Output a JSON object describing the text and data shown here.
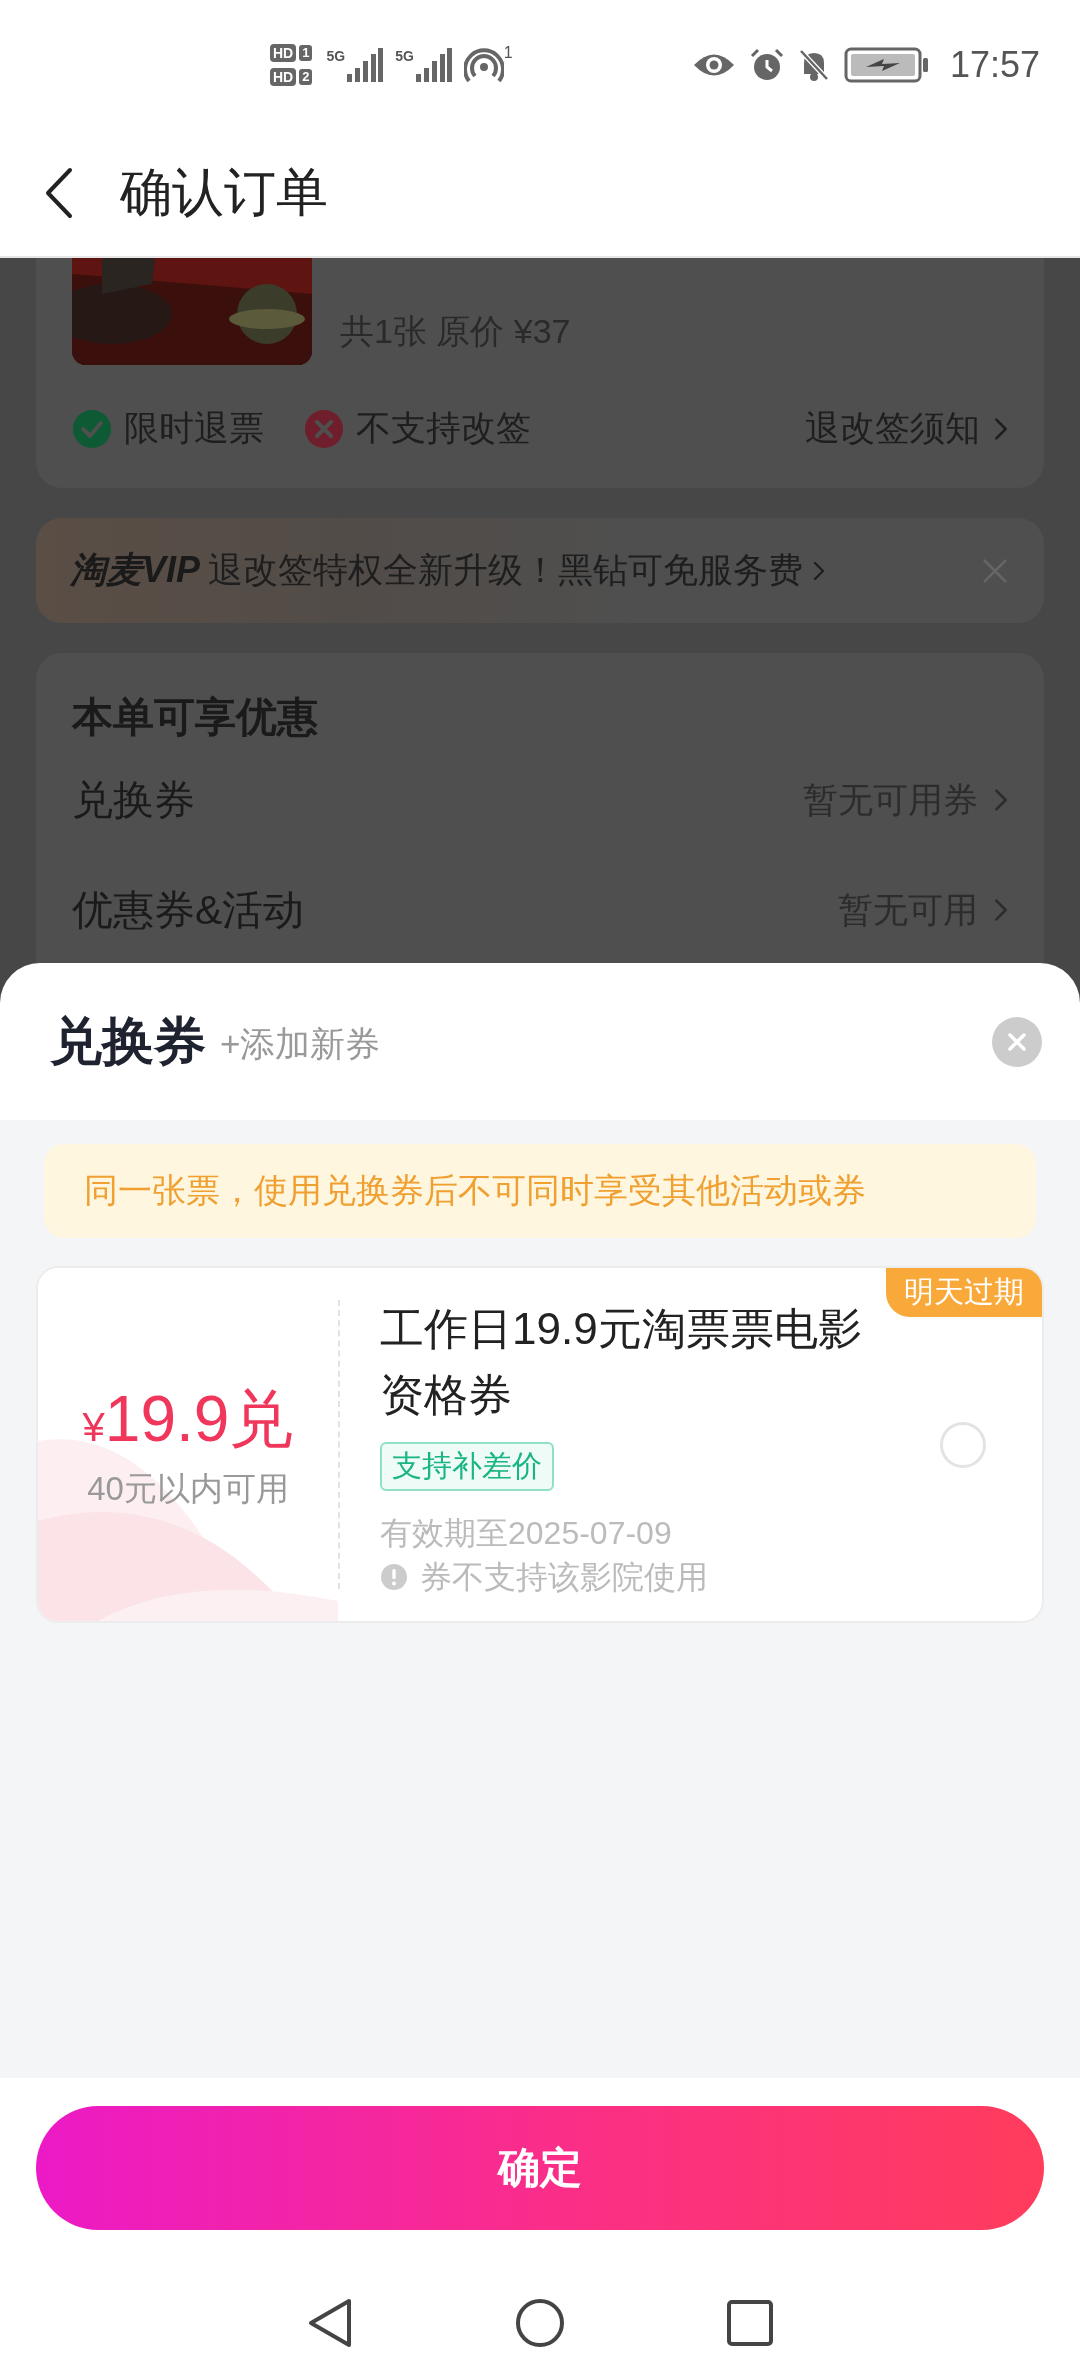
{
  "status_bar": {
    "sims": [
      {
        "label": "HD",
        "slot": "1"
      },
      {
        "label": "HD",
        "slot": "2"
      }
    ],
    "networks": [
      {
        "label": "5G"
      },
      {
        "label": "5G"
      }
    ],
    "hotspot_count": "1",
    "time": "17:57"
  },
  "header": {
    "title": "确认订单"
  },
  "order": {
    "ticket_info": "共1张 原价 ¥37",
    "policies": [
      {
        "kind": "ok",
        "label": "限时退票"
      },
      {
        "kind": "no",
        "label": "不支持改签"
      }
    ],
    "policy_link": "退改签须知"
  },
  "vip_banner": {
    "logo": "淘麦VIP",
    "text": "退改签特权全新升级！黑钻可免服务费"
  },
  "discounts": {
    "title": "本单可享优惠",
    "rows": [
      {
        "label": "兑换券",
        "value": "暂无可用券"
      },
      {
        "label": "优惠券&活动",
        "value": "暂无可用"
      }
    ]
  },
  "sheet": {
    "title": "兑换券",
    "add_link": "+添加新券",
    "notice": "同一张票，使用兑换券后不可同时享受其他活动或券",
    "coupons": [
      {
        "currency": "¥",
        "amount": "19.9兑",
        "condition": "40元以内可用",
        "badge": "明天过期",
        "title": "工作日19.9元淘票票电影资格券",
        "tag": "支持补差价",
        "validity": "有效期至2025-07-09",
        "warning": "券不支持该影院使用",
        "selected": false
      }
    ],
    "confirm": "确定"
  }
}
